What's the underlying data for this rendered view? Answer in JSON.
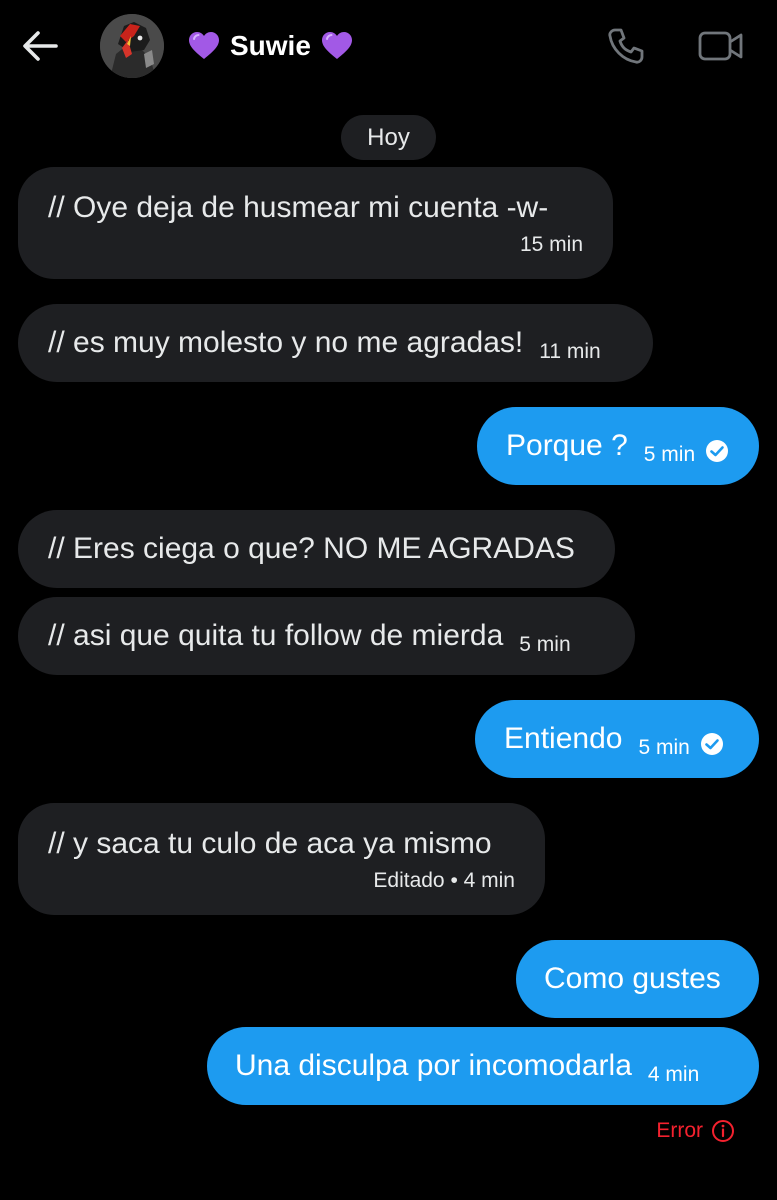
{
  "header": {
    "contact_name": "Suwie",
    "back_icon": "arrow-left-icon",
    "call_icon": "phone-icon",
    "video_icon": "video-camera-icon",
    "name_emoji": "purple-heart"
  },
  "date_separator": "Hoy",
  "messages": [
    {
      "direction": "incoming",
      "text": "// Oye deja de husmear mi cuenta -w-",
      "time": "15 min"
    },
    {
      "direction": "incoming",
      "text": "// es muy molesto y no me agradas!",
      "time": "11 min"
    },
    {
      "direction": "outgoing",
      "text": "Porque ?",
      "time": "5 min",
      "status": "read"
    },
    {
      "direction": "incoming",
      "text": "// Eres ciega o que? NO ME AGRADAS",
      "time": ""
    },
    {
      "direction": "incoming",
      "text": "// asi que quita tu follow de mierda",
      "time": "5 min"
    },
    {
      "direction": "outgoing",
      "text": "Entiendo",
      "time": "5 min",
      "status": "read"
    },
    {
      "direction": "incoming",
      "text": "// y saca tu culo de aca ya mismo",
      "time": "Editado • 4 min"
    },
    {
      "direction": "outgoing",
      "text": "Como gustes",
      "time": ""
    },
    {
      "direction": "outgoing",
      "text": "Una disculpa por incomodarla",
      "time": "4 min"
    }
  ],
  "error_label": "Error",
  "colors": {
    "background": "#000000",
    "incoming_bubble": "#1e1f22",
    "outgoing_bubble": "#1d9bf0",
    "error": "#f4212e"
  }
}
